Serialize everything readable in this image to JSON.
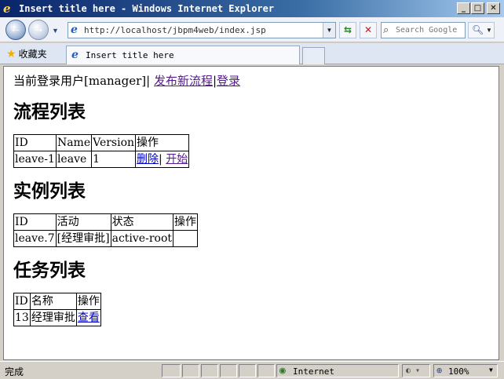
{
  "window": {
    "title": "Insert title here - Windows Internet Explorer",
    "minimize_glyph": "_",
    "maximize_glyph": "□",
    "close_glyph": "✕"
  },
  "toolbar": {
    "address": "http://localhost/jbpm4web/index.jsp",
    "search_placeholder": "Search Google"
  },
  "tabs": {
    "favorites_label": "收藏夹",
    "active_tab_label": "Insert title here"
  },
  "content": {
    "current_user_prefix": "当前登录用户[manager]|",
    "publish_link": "发布新流程",
    "separator": "|",
    "login_link": "登录",
    "process_section": {
      "heading": "流程列表",
      "columns": [
        "ID",
        "Name",
        "Version",
        "操作"
      ],
      "rows": [
        {
          "id": "leave-1",
          "name": "leave",
          "version": "1",
          "delete_label": "删除",
          "sep": "|",
          "start_label": "开始"
        }
      ]
    },
    "instance_section": {
      "heading": "实例列表",
      "columns": [
        "ID",
        "活动",
        "状态",
        "操作"
      ],
      "rows": [
        {
          "id": "leave.7",
          "activity": "[经理审批]",
          "state": "active-root",
          "action": ""
        }
      ]
    },
    "task_section": {
      "heading": "任务列表",
      "columns": [
        "ID",
        "名称",
        "操作"
      ],
      "rows": [
        {
          "id": "13",
          "name": "经理审批",
          "view_label": "查看"
        }
      ]
    }
  },
  "statusbar": {
    "status_text": "完成",
    "zone_label": "Internet",
    "protected_mode": "◐ ▾",
    "zoom_label": "100%"
  }
}
